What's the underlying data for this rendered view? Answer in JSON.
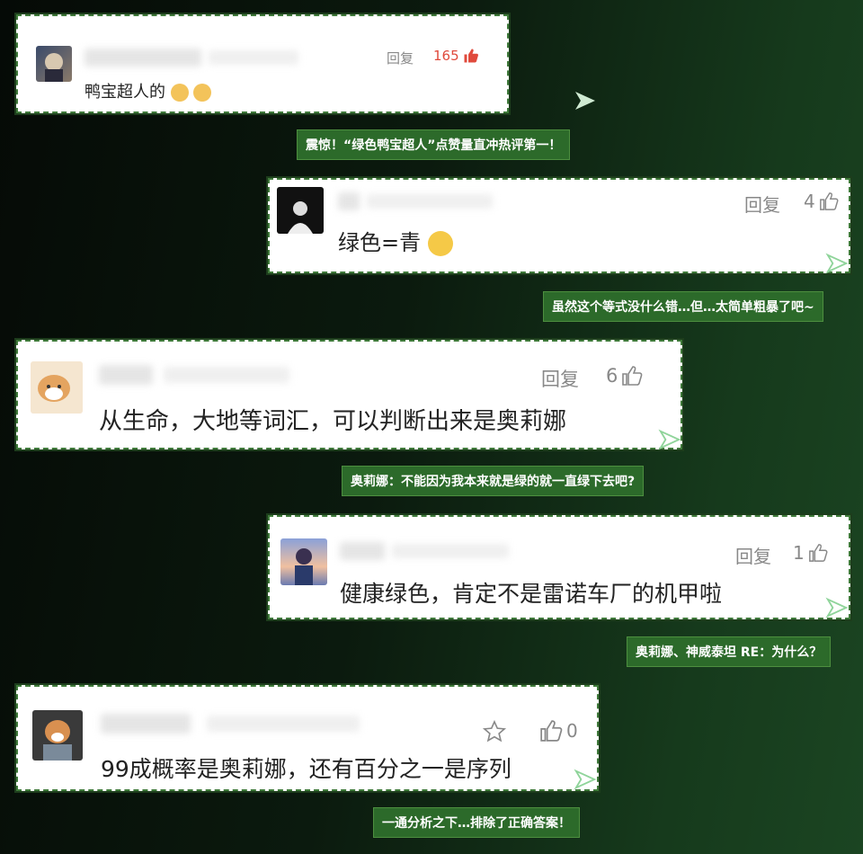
{
  "reply_label": "回复",
  "comments": [
    {
      "text": "鸭宝超人的",
      "likes": "165",
      "emoji": "cat-face-emojis"
    },
    {
      "text": "绿色=青",
      "likes": "4",
      "emoji": "dizzy-face-emoji"
    },
    {
      "text": "从生命，大地等词汇，可以判断出来是奥莉娜",
      "likes": "6"
    },
    {
      "text": "健康绿色，肯定不是雷诺车厂的机甲啦",
      "likes": "1"
    },
    {
      "text": "99成概率是奥莉娜，还有百分之一是序列",
      "likes": "0"
    }
  ],
  "captions": [
    "震惊！“绿色鸭宝超人”点赞量直冲热评第一！",
    "虽然这个等式没什么错…但…太简单粗暴了吧~",
    "奥莉娜：不能因为我本来就是绿的就一直绿下去吧?",
    "奥莉娜、神威泰坦 RE：为什么？",
    "一通分析之下…排除了正确答案！"
  ],
  "colors": {
    "like_red": "#e04a3c",
    "caption_bg": "#2c6a2a",
    "arrow_green": "#8fd49a"
  }
}
